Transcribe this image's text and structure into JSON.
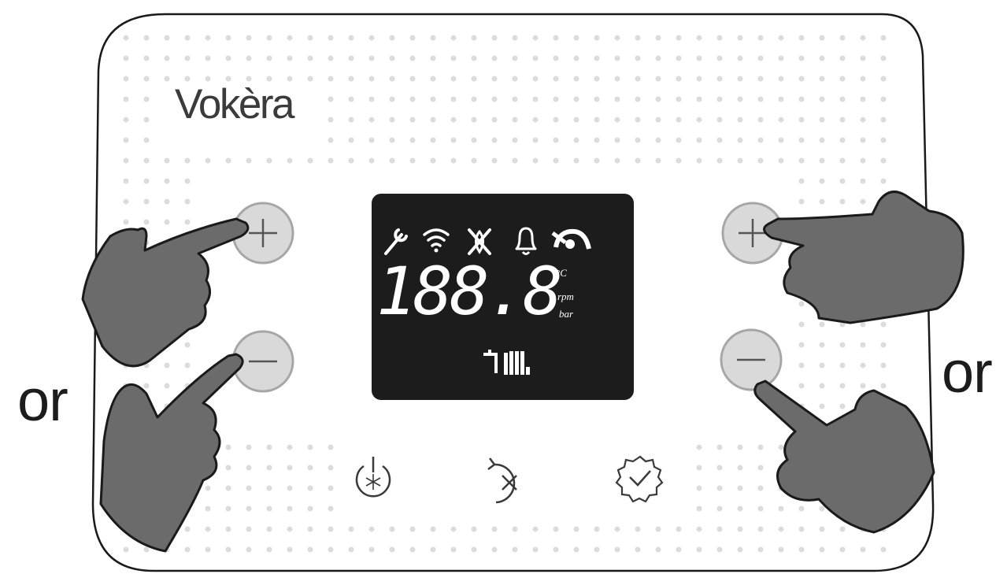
{
  "brand": {
    "name": "Vokèra"
  },
  "labels": {
    "or_left": "or",
    "or_right": "or"
  },
  "display": {
    "digits": "188.8",
    "units": {
      "celsius": "°C",
      "rpm": "rpm",
      "bar": "bar"
    },
    "top_icons": [
      "wrench-icon",
      "wifi-icon",
      "flame-off-icon",
      "bell-icon",
      "pump-icon"
    ],
    "bottom_icons": [
      "tap-icon",
      "radiator-icon"
    ]
  },
  "buttons": {
    "left": [
      "plus-button",
      "minus-button"
    ],
    "right": [
      "plus-button",
      "minus-button"
    ],
    "bottom": [
      "power-frost-button",
      "reset-button",
      "settings-button"
    ]
  },
  "colors": {
    "panel_outline": "#1a1a1a",
    "dot": "#dcdcdc",
    "button_fill": "#d9d9d9",
    "button_ring": "#a6a6a6",
    "hand_fill": "#6b6b6b",
    "lcd_background": "#1c1c1c",
    "lcd_text": "#ffffff"
  }
}
